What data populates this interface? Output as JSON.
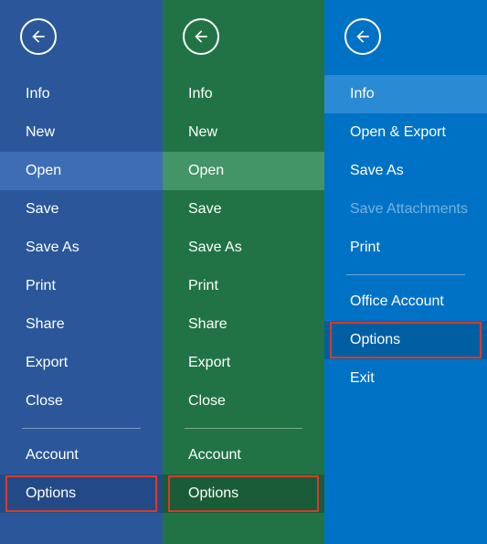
{
  "panels": [
    {
      "class": "panel-word",
      "items": [
        {
          "label": "Info"
        },
        {
          "label": "New"
        },
        {
          "label": "Open",
          "selected": true
        },
        {
          "label": "Save"
        },
        {
          "label": "Save As"
        },
        {
          "label": "Print"
        },
        {
          "label": "Share"
        },
        {
          "label": "Export"
        },
        {
          "label": "Close"
        }
      ],
      "footer": [
        {
          "label": "Account"
        },
        {
          "label": "Options",
          "boxed": true
        }
      ]
    },
    {
      "class": "panel-excel",
      "items": [
        {
          "label": "Info"
        },
        {
          "label": "New"
        },
        {
          "label": "Open",
          "selected": true
        },
        {
          "label": "Save"
        },
        {
          "label": "Save As"
        },
        {
          "label": "Print"
        },
        {
          "label": "Share"
        },
        {
          "label": "Export"
        },
        {
          "label": "Close"
        }
      ],
      "footer": [
        {
          "label": "Account"
        },
        {
          "label": "Options",
          "boxed": true
        }
      ]
    },
    {
      "class": "panel-outlook",
      "items": [
        {
          "label": "Info",
          "selected": true
        },
        {
          "label": "Open & Export"
        },
        {
          "label": "Save As"
        },
        {
          "label": "Save Attachments",
          "disabled": true
        },
        {
          "label": "Print"
        }
      ],
      "footer": [
        {
          "label": "Office Account"
        },
        {
          "label": "Options",
          "boxed": true
        },
        {
          "label": "Exit"
        }
      ]
    }
  ]
}
